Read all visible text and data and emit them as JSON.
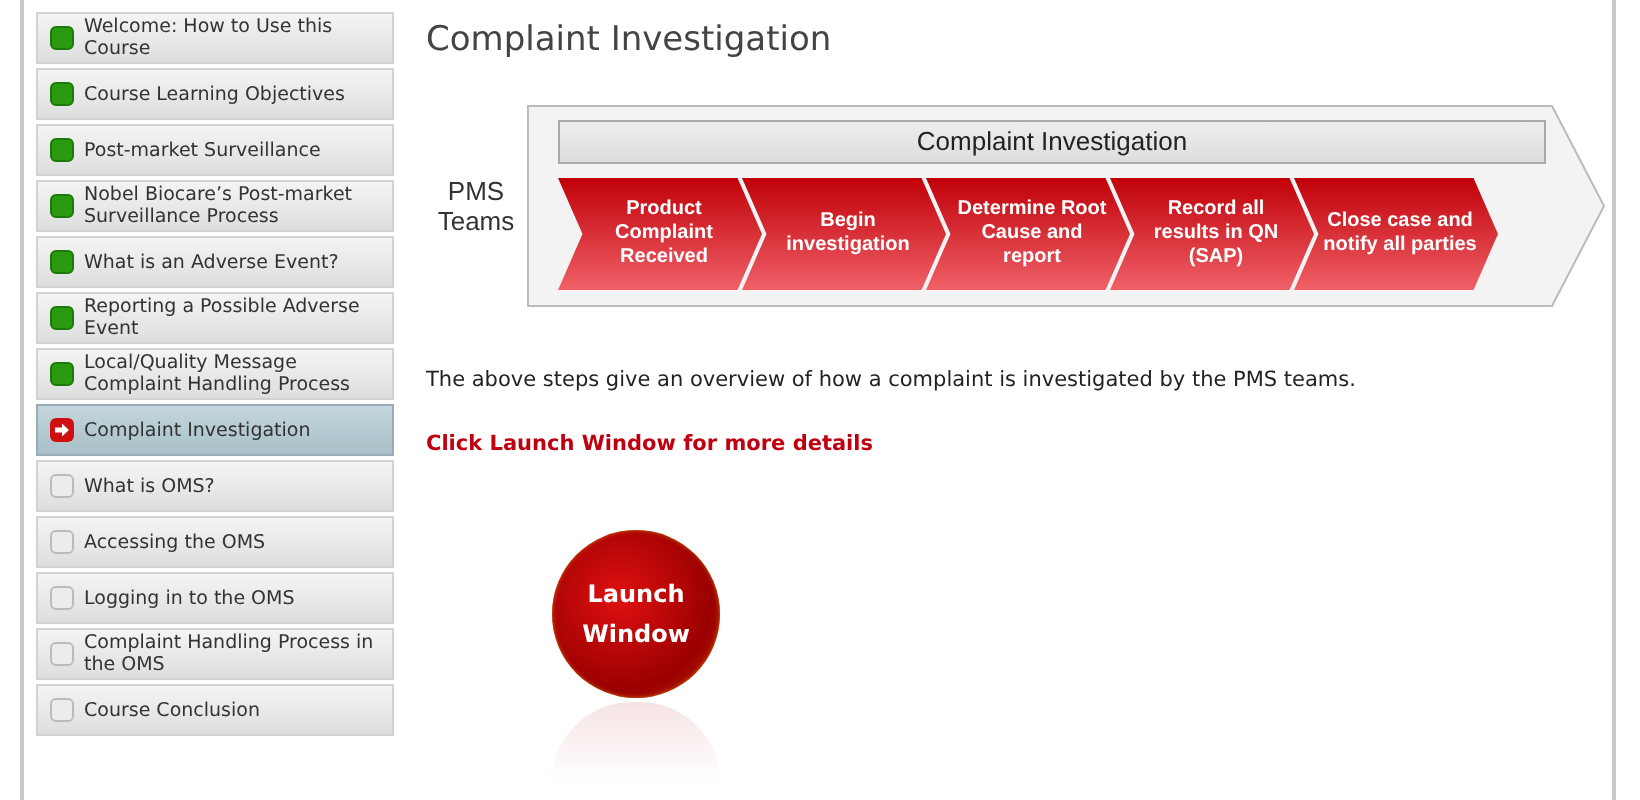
{
  "sidebar": {
    "items": [
      {
        "label": "Welcome: How to Use this Course",
        "kind": "complete",
        "selected": false
      },
      {
        "label": "Course Learning Objectives",
        "kind": "complete",
        "selected": false
      },
      {
        "label": "Post-market Surveillance",
        "kind": "complete",
        "selected": false
      },
      {
        "label": "Nobel Biocare’s Post-market Surveillance Process",
        "kind": "complete",
        "selected": false
      },
      {
        "label": "What is an Adverse Event?",
        "kind": "complete",
        "selected": false
      },
      {
        "label": "Reporting a Possible Adverse Event",
        "kind": "complete",
        "selected": false
      },
      {
        "label": "Local/Quality Message Complaint Handling Process",
        "kind": "complete",
        "selected": false
      },
      {
        "label": "Complaint Investigation",
        "kind": "current",
        "selected": true
      },
      {
        "label": "What is OMS?",
        "kind": "pending",
        "selected": false
      },
      {
        "label": "Accessing the OMS",
        "kind": "pending",
        "selected": false
      },
      {
        "label": "Logging in to the OMS",
        "kind": "pending",
        "selected": false
      },
      {
        "label": "Complaint Handling Process in the OMS",
        "kind": "pending",
        "selected": false
      },
      {
        "label": "Course Conclusion",
        "kind": "pending",
        "selected": false
      }
    ]
  },
  "page": {
    "title": "Complaint Investigation",
    "diagram": {
      "row_label": "PMS Teams",
      "header": "Complaint Investigation",
      "steps": [
        "Product Complaint Received",
        "Begin investigation",
        "Determine Root Cause and report",
        "Record all results in QN (SAP)",
        "Close case and notify all parties"
      ]
    },
    "description": "The above steps give an overview of how a complaint is investigated by the PMS teams.",
    "instruction": "Click Launch Window for more details",
    "launch_button": "Launch Window"
  }
}
